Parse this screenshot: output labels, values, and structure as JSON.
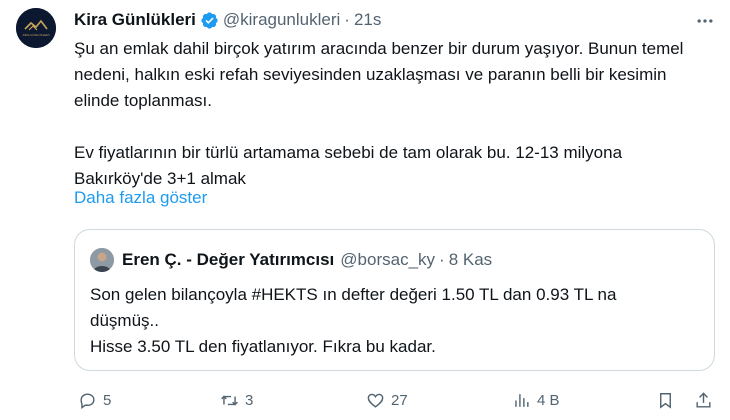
{
  "tweet": {
    "author_name": "Kira Günlükleri",
    "author_handle": "@kiragunlukleri",
    "separator": "·",
    "time": "21s",
    "avatar_label": "KİRA GÜNLÜKLERİ",
    "paragraph1": "Şu an emlak dahil birçok yatırım aracında benzer bir durum yaşıyor. Bunun temel nedeni, halkın eski refah seviyesinden uzaklaşması ve paranın belli bir kesimin elinde toplanması.",
    "paragraph2": "Ev fiyatlarının bir türlü artamama sebebi de tam olarak bu. 12-13 milyona Bakırköy'de 3+1 almak",
    "show_more": "Daha fazla göster"
  },
  "quote": {
    "author_name": "Eren Ç. - Değer Yatırımcısı",
    "author_handle": "@borsac_ky",
    "separator": "·",
    "time": "8 Kas",
    "line1": "Son gelen bilançoyla #HEKTS ın defter değeri 1.50 TL dan 0.93 TL na",
    "line2": "düşmüş..",
    "line3": "Hisse 3.50 TL den fiyatlanıyor. Fıkra bu kadar."
  },
  "actions": {
    "reply_count": "5",
    "retweet_count": "3",
    "like_count": "27",
    "views_count": "4 B"
  },
  "icons": {
    "verified": "verified-badge-icon",
    "more": "more-options-icon",
    "reply": "reply-icon",
    "retweet": "retweet-icon",
    "like": "heart-icon",
    "views": "views-icon",
    "bookmark": "bookmark-icon"
  },
  "colors": {
    "accent": "#1d9bf0",
    "text": "#0f1419",
    "muted": "#536471",
    "border": "#cfd9de"
  }
}
